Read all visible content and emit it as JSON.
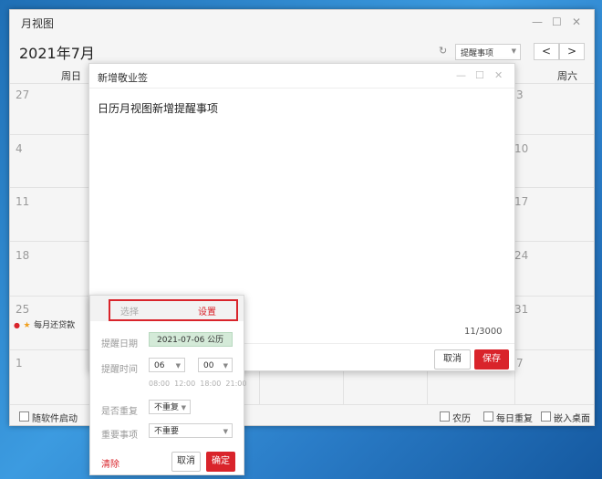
{
  "window": {
    "title": "月视图",
    "month_title": "2021年7月",
    "reminder_dropdown": "提醒事项",
    "prev": "<",
    "next": ">"
  },
  "weekdays": {
    "sun": "周日",
    "sat": "周六"
  },
  "calendar": {
    "left_days": [
      "27",
      "4",
      "11",
      "18",
      "25",
      "1"
    ],
    "right_days": [
      "3",
      "10",
      "17",
      "24",
      "31",
      "7"
    ],
    "event": "每月还贷款"
  },
  "footer": {
    "autostart": "随软件启动",
    "lunar": "农历",
    "daily_repeat": "每日重复",
    "embed_desktop": "嵌入桌面"
  },
  "note": {
    "title": "新增敬业签",
    "content": "日历月视图新增提醒事项",
    "counter": "11/3000",
    "cancel": "取消",
    "save": "保存"
  },
  "popup": {
    "tab_select": "选择",
    "tab_settings": "设置",
    "date_label": "提醒日期",
    "date_value": "2021-07-06 公历",
    "time_label": "提醒时间",
    "hour": "06",
    "minute": "00",
    "quick_times": "08:00  12:00  18:00  21:00",
    "repeat_label": "是否重复",
    "repeat_value": "不重复",
    "important_label": "重要事项",
    "important_value": "不重要",
    "clear": "清除",
    "cancel": "取消",
    "confirm": "确定"
  },
  "colors": {
    "accent": "#d9242b",
    "date_bg": "#d4ead8"
  }
}
